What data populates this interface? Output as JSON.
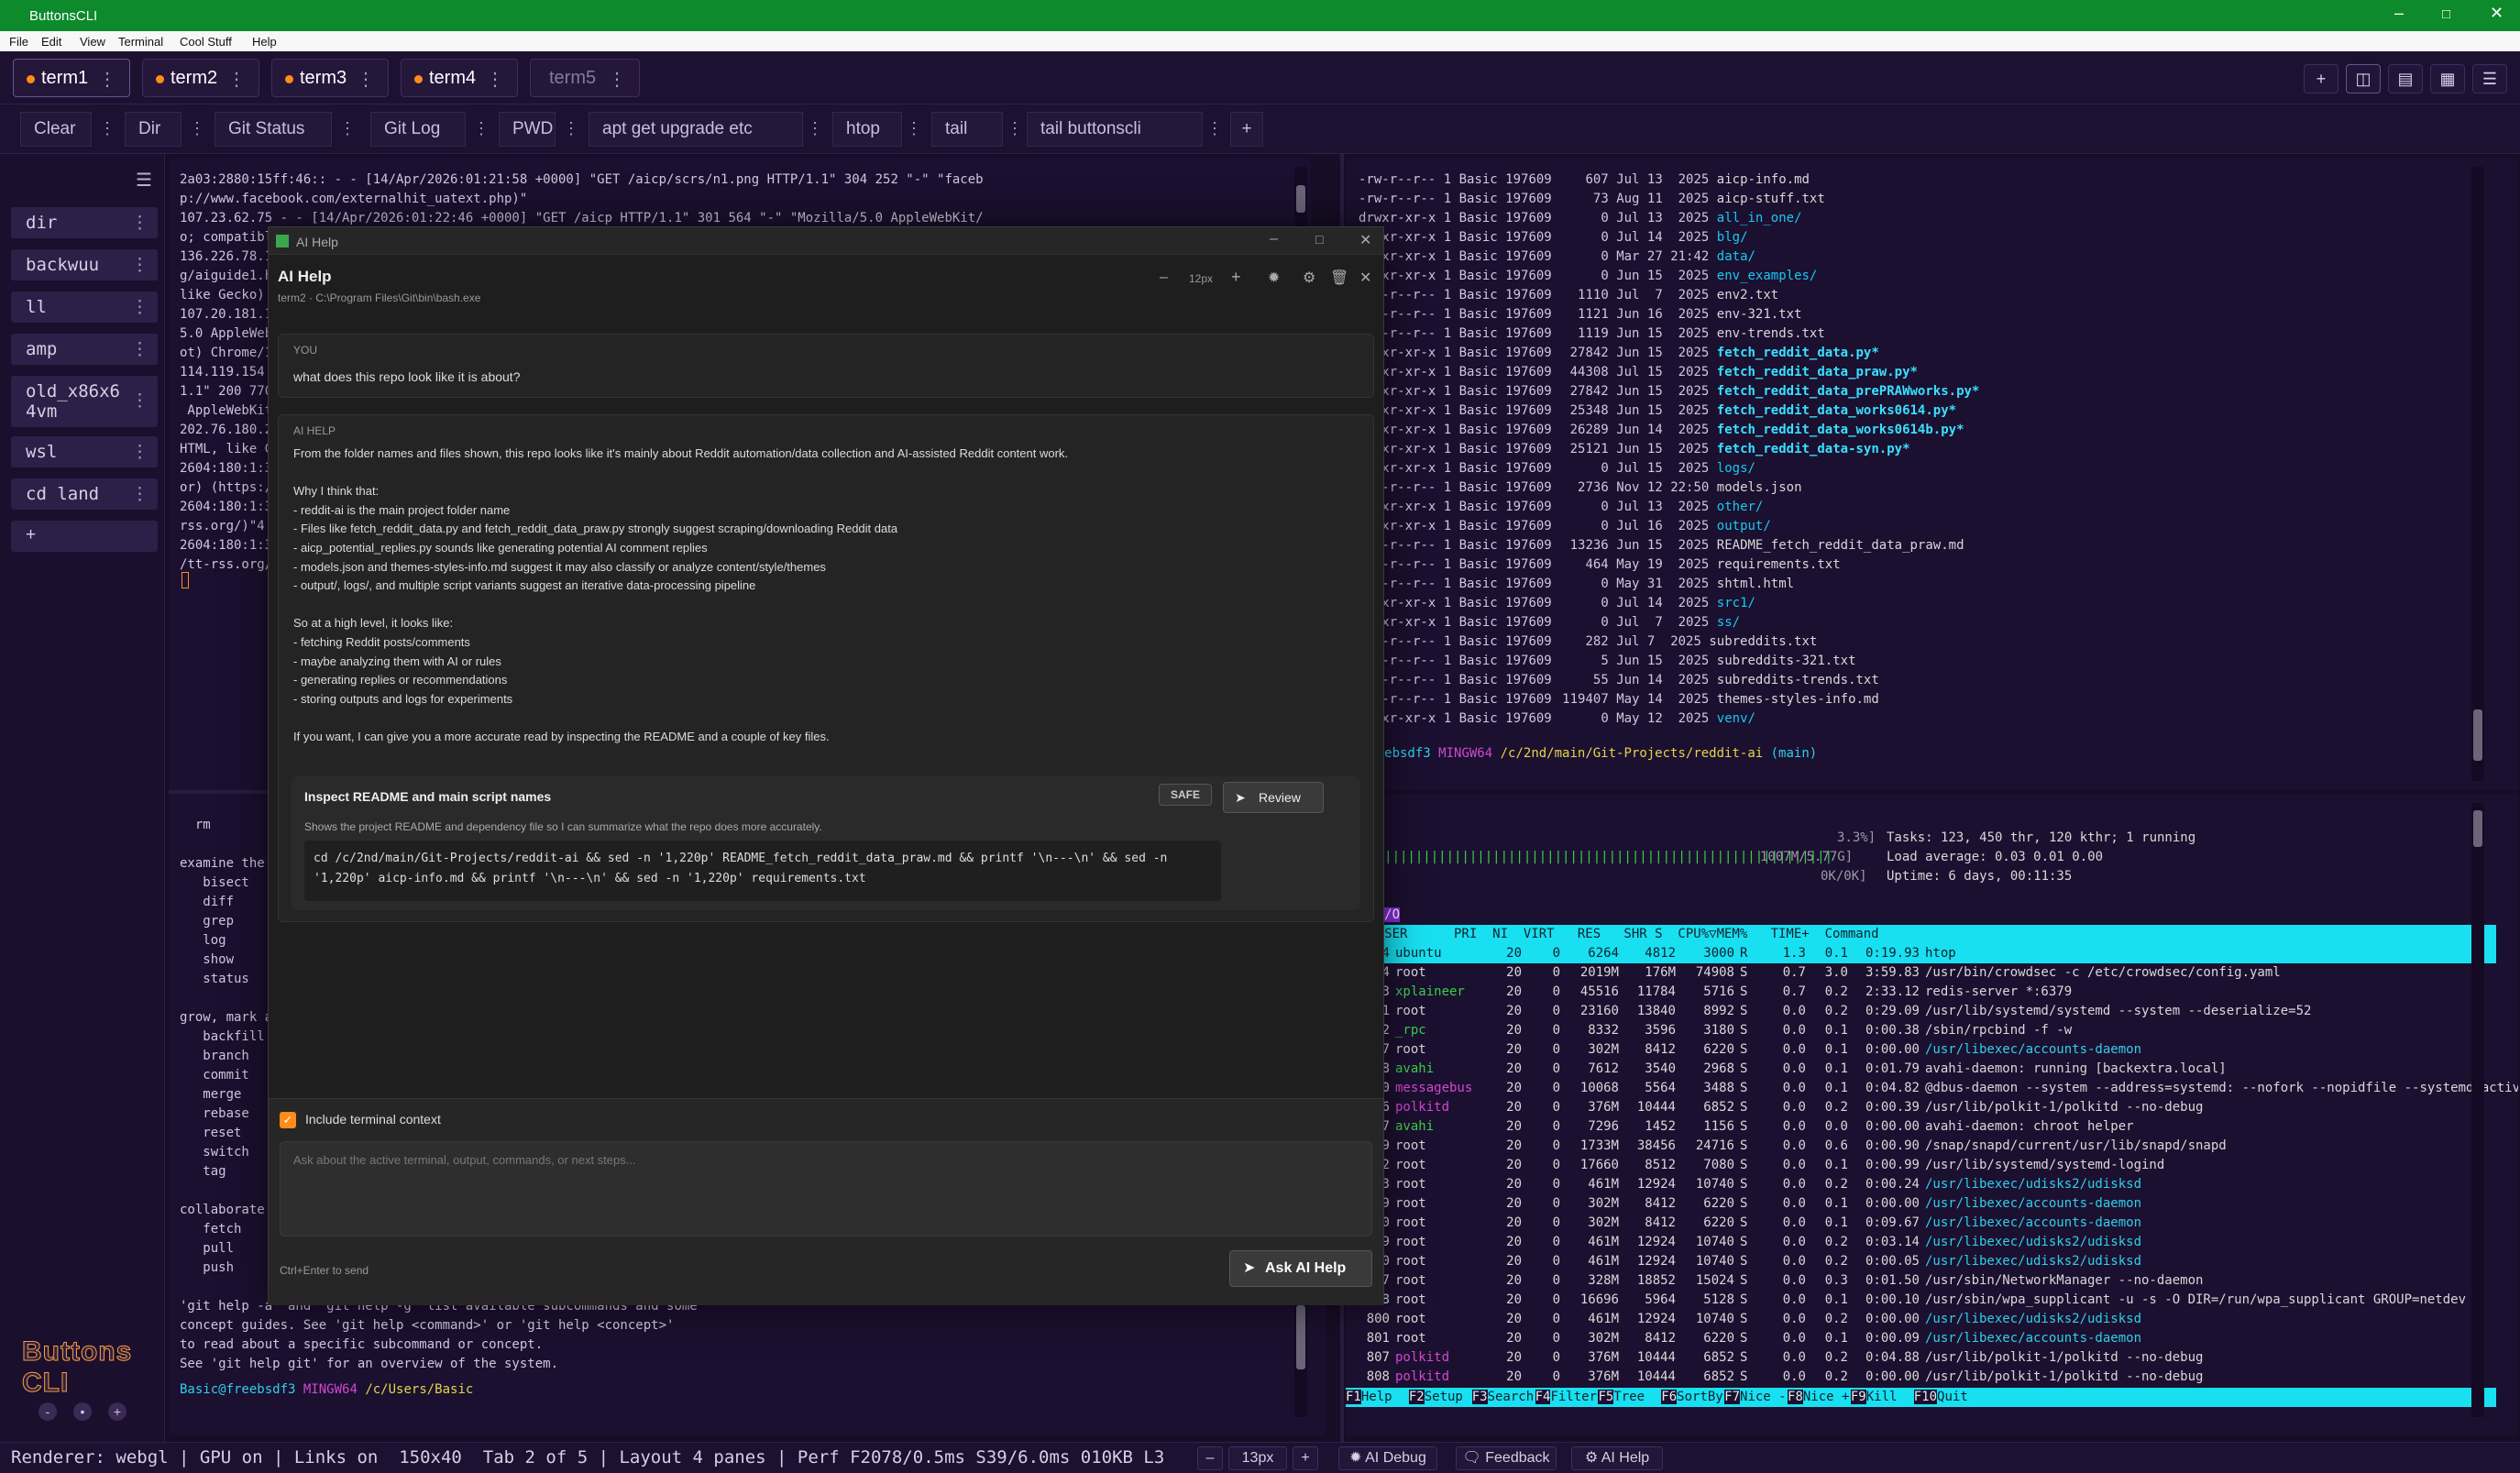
{
  "app": {
    "title": "ButtonsCLI",
    "brand": "Buttons CLI"
  },
  "menu": [
    "File",
    "Edit",
    "View",
    "Terminal",
    "Cool Stuff",
    "Help"
  ],
  "tabs": [
    {
      "label": "term1"
    },
    {
      "label": "term2"
    },
    {
      "label": "term3"
    },
    {
      "label": "term4"
    },
    {
      "label": "term5"
    }
  ],
  "toolbar": [
    "Clear",
    "Dir",
    "Git Status",
    "Git Log",
    "PWD",
    "apt get upgrade etc",
    "htop",
    "tail",
    "tail buttonscli"
  ],
  "toolbar_add": "+",
  "sidebar": [
    "dir",
    "backwuu",
    "ll",
    "amp",
    "old_x86x6\n4vm",
    "wsl",
    "cd land"
  ],
  "sidebar_add": "+",
  "sidebar_controls": [
    "-",
    "•",
    "+"
  ],
  "pane1_lines": [
    "2a03:2880:15ff:46:: - - [14/Apr/2026:01:21:58 +0000] \"GET /aicp/scrs/n1.png HTTP/1.1\" 304 252 \"-\" \"faceb",
    "p://www.facebook.com/externalhit_uatext.php)\"",
    "107.23.62.75 - - [14/Apr/2026:01:22:46 +0000] \"GET /aicp HTTP/1.1\" 301 564 \"-\" \"Mozilla/5.0 AppleWebKit/",
    "o; compatibl",
    "136.226.78.1",
    "g/aiguide1.h",
    "like Gecko)",
    "107.20.181.1",
    "5.0 AppleWeb",
    "ot) Chrome/1",
    "114.119.154.",
    "1.1\" 200 770",
    " AppleWebKit",
    "202.76.180.2",
    "HTML, like G",
    "2604:180:1:3",
    "or) (https:/",
    "2604:180:1:3",
    "rss.org/)\"4.",
    "2604:180:1:3",
    "/tt-rss.org/"
  ],
  "pane3_lines": [
    "  rm",
    "",
    "examine the",
    "   bisect",
    "   diff",
    "   grep",
    "   log",
    "   show",
    "   status",
    "",
    "grow, mark a",
    "   backfill",
    "   branch",
    "   commit",
    "   merge",
    "   rebase",
    "   reset",
    "   switch",
    "   tag",
    "",
    "collaborate",
    "   fetch",
    "   pull",
    "   push",
    "",
    "'git help -a' and 'git help -g' list available subcommands and some",
    "concept guides. See 'git help <command>' or 'git help <concept>'",
    "to read about a specific subcommand or concept.",
    "See 'git help git' for an overview of the system."
  ],
  "pane3_prompt": {
    "user": "Basic@freebsdf3",
    "env": "MINGW64",
    "path": "/c/Users/Basic"
  },
  "pane2_files": [
    {
      "p": "-rw-r--r--",
      "s": "607",
      "d": "Jul 13  2025",
      "n": "aicp-info.md",
      "c": "plain"
    },
    {
      "p": "-rw-r--r--",
      "s": "73",
      "d": "Aug 11  2025",
      "n": "aicp-stuff.txt",
      "c": "plain"
    },
    {
      "p": "drwxr-xr-x",
      "s": "0",
      "d": "Jul 13  2025",
      "n": "all_in_one/",
      "c": "dir"
    },
    {
      "p": "drwxr-xr-x",
      "s": "0",
      "d": "Jul 14  2025",
      "n": "blg/",
      "c": "dir"
    },
    {
      "p": "drwxr-xr-x",
      "s": "0",
      "d": "Mar 27 21:42",
      "n": "data/",
      "c": "dir"
    },
    {
      "p": "drwxr-xr-x",
      "s": "0",
      "d": "Jun 15  2025",
      "n": "env_examples/",
      "c": "dir"
    },
    {
      "p": "-rw-r--r--",
      "s": "1110",
      "d": "Jul  7  2025",
      "n": "env2.txt",
      "c": "plain"
    },
    {
      "p": "-rw-r--r--",
      "s": "1121",
      "d": "Jun 16  2025",
      "n": "env-321.txt",
      "c": "plain"
    },
    {
      "p": "-rw-r--r--",
      "s": "1119",
      "d": "Jun 15  2025",
      "n": "env-trends.txt",
      "c": "plain"
    },
    {
      "p": "-rwxr-xr-x",
      "s": "27842",
      "d": "Jun 15  2025",
      "n": "fetch_reddit_data.py*",
      "c": "exe"
    },
    {
      "p": "-rwxr-xr-x",
      "s": "44308",
      "d": "Jul 15  2025",
      "n": "fetch_reddit_data_praw.py*",
      "c": "exe"
    },
    {
      "p": "-rwxr-xr-x",
      "s": "27842",
      "d": "Jun 15  2025",
      "n": "fetch_reddit_data_prePRAWworks.py*",
      "c": "exe"
    },
    {
      "p": "-rwxr-xr-x",
      "s": "25348",
      "d": "Jun 15  2025",
      "n": "fetch_reddit_data_works0614.py*",
      "c": "exe"
    },
    {
      "p": "-rwxr-xr-x",
      "s": "26289",
      "d": "Jun 14  2025",
      "n": "fetch_reddit_data_works0614b.py*",
      "c": "exe"
    },
    {
      "p": "-rwxr-xr-x",
      "s": "25121",
      "d": "Jun 15  2025",
      "n": "fetch_reddit_data-syn.py*",
      "c": "exe"
    },
    {
      "p": "drwxr-xr-x",
      "s": "0",
      "d": "Jul 15  2025",
      "n": "logs/",
      "c": "dir"
    },
    {
      "p": "-rw-r--r--",
      "s": "2736",
      "d": "Nov 12 22:50",
      "n": "models.json",
      "c": "plain"
    },
    {
      "p": "drwxr-xr-x",
      "s": "0",
      "d": "Jul 13  2025",
      "n": "other/",
      "c": "dir"
    },
    {
      "p": "drwxr-xr-x",
      "s": "0",
      "d": "Jul 16  2025",
      "n": "output/",
      "c": "dir"
    },
    {
      "p": "-rw-r--r--",
      "s": "13236",
      "d": "Jun 15  2025",
      "n": "README_fetch_reddit_data_praw.md",
      "c": "plain"
    },
    {
      "p": "-rw-r--r--",
      "s": "464",
      "d": "May 19  2025",
      "n": "requirements.txt",
      "c": "plain"
    },
    {
      "p": "-rw-r--r--",
      "s": "0",
      "d": "May 31  2025",
      "n": "shtml.html",
      "c": "plain"
    },
    {
      "p": "drwxr-xr-x",
      "s": "0",
      "d": "Jul 14  2025",
      "n": "src1/",
      "c": "dir"
    },
    {
      "p": "drwxr-xr-x",
      "s": "0",
      "d": "Jul  7  2025",
      "n": "ss/",
      "c": "dir"
    },
    {
      "p": "-rw-r--r--",
      "s": "282",
      "d": "Jul 7  2025",
      "n": "subreddits.txt",
      "c": "plain"
    },
    {
      "p": "-rw-r--r--",
      "s": "5",
      "d": "Jun 15  2025",
      "n": "subreddits-321.txt",
      "c": "plain"
    },
    {
      "p": "-rw-r--r--",
      "s": "55",
      "d": "Jun 14  2025",
      "n": "subreddits-trends.txt",
      "c": "plain"
    },
    {
      "p": "-rw-r--r--",
      "s": "119407",
      "d": "May 14  2025",
      "n": "themes-styles-info.md",
      "c": "plain"
    },
    {
      "p": "drwxr-xr-x",
      "s": "0",
      "d": "May 12  2025",
      "n": "venv/",
      "c": "dir"
    }
  ],
  "pane2_links": "1 Basic 197609",
  "pane2_prompt": {
    "user": "c@freebsdf3",
    "env": "MINGW64",
    "path": "/c/2nd/main/Git-Projects/reddit-ai",
    "branch": "(main)"
  },
  "htop": {
    "cpu_right": "3.3%]",
    "tasks": "Tasks: 123, 450 thr, 120 kthr; 1 running",
    "mem_right": "1007M/5.77G]",
    "load": "Load average: 0.03 0.01 0.00",
    "swp_right": "0K/0K]",
    "uptime": "Uptime: 6 days, 00:11:35",
    "tab_main": "ain",
    "tab_io": "I/O",
    "header": "PID USER      PRI  NI  VIRT   RES   SHR S  CPU%▽MEM%   TIME+  Command",
    "rows": [
      [
        "224",
        "ubuntu",
        "20",
        "0",
        "6264",
        "4812",
        "3000",
        "R",
        "1.3",
        "0.1",
        "0:19.93",
        "htop"
      ],
      [
        "704",
        "root",
        "20",
        "0",
        "2019M",
        "176M",
        "74908",
        "S",
        "0.7",
        "3.0",
        "3:59.83",
        "/usr/bin/crowdsec -c /etc/crowdsec/config.yaml"
      ],
      [
        "253",
        "xplaineer",
        "20",
        "0",
        "45516",
        "11784",
        "5716",
        "S",
        "0.7",
        "0.2",
        "2:33.12",
        "redis-server *:6379"
      ],
      [
        "1",
        "root",
        "20",
        "0",
        "23160",
        "13840",
        "8992",
        "S",
        "0.0",
        "0.2",
        "0:29.09",
        "/usr/lib/systemd/systemd --system --deserialize=52"
      ],
      [
        "512",
        "_rpc",
        "20",
        "0",
        "8332",
        "3596",
        "3180",
        "S",
        "0.0",
        "0.1",
        "0:00.38",
        "/sbin/rpcbind -f -w"
      ],
      [
        "737",
        "root",
        "20",
        "0",
        "302M",
        "8412",
        "6220",
        "S",
        "0.0",
        "0.1",
        "0:00.00",
        "/usr/libexec/accounts-daemon"
      ],
      [
        "738",
        "avahi",
        "20",
        "0",
        "7612",
        "3540",
        "2968",
        "S",
        "0.0",
        "0.1",
        "0:01.79",
        "avahi-daemon: running [backextra.local]"
      ],
      [
        "740",
        "messagebus",
        "20",
        "0",
        "10068",
        "5564",
        "3488",
        "S",
        "0.0",
        "0.1",
        "0:04.82",
        "@dbus-daemon --system --address=systemd: --nofork --nopidfile --systemd-activation --"
      ],
      [
        "746",
        "polkitd",
        "20",
        "0",
        "376M",
        "10444",
        "6852",
        "S",
        "0.0",
        "0.2",
        "0:00.39",
        "/usr/lib/polkit-1/polkitd --no-debug"
      ],
      [
        "747",
        "avahi",
        "20",
        "0",
        "7296",
        "1452",
        "1156",
        "S",
        "0.0",
        "0.0",
        "0:00.00",
        "avahi-daemon: chroot helper"
      ],
      [
        "749",
        "root",
        "20",
        "0",
        "1733M",
        "38456",
        "24716",
        "S",
        "0.0",
        "0.6",
        "0:00.90",
        "/snap/snapd/current/usr/lib/snapd/snapd"
      ],
      [
        "752",
        "root",
        "20",
        "0",
        "17660",
        "8512",
        "7080",
        "S",
        "0.0",
        "0.1",
        "0:00.99",
        "/usr/lib/systemd/systemd-logind"
      ],
      [
        "753",
        "root",
        "20",
        "0",
        "461M",
        "12924",
        "10740",
        "S",
        "0.0",
        "0.2",
        "0:00.24",
        "/usr/libexec/udisks2/udisksd"
      ],
      [
        "769",
        "root",
        "20",
        "0",
        "302M",
        "8412",
        "6220",
        "S",
        "0.0",
        "0.1",
        "0:00.00",
        "/usr/libexec/accounts-daemon"
      ],
      [
        "770",
        "root",
        "20",
        "0",
        "302M",
        "8412",
        "6220",
        "S",
        "0.0",
        "0.1",
        "0:09.67",
        "/usr/libexec/accounts-daemon"
      ],
      [
        "779",
        "root",
        "20",
        "0",
        "461M",
        "12924",
        "10740",
        "S",
        "0.0",
        "0.2",
        "0:03.14",
        "/usr/libexec/udisks2/udisksd"
      ],
      [
        "780",
        "root",
        "20",
        "0",
        "461M",
        "12924",
        "10740",
        "S",
        "0.0",
        "0.2",
        "0:00.05",
        "/usr/libexec/udisks2/udisksd"
      ],
      [
        "797",
        "root",
        "20",
        "0",
        "328M",
        "18852",
        "15024",
        "S",
        "0.0",
        "0.3",
        "0:01.50",
        "/usr/sbin/NetworkManager --no-daemon"
      ],
      [
        "798",
        "root",
        "20",
        "0",
        "16696",
        "5964",
        "5128",
        "S",
        "0.0",
        "0.1",
        "0:00.10",
        "/usr/sbin/wpa_supplicant -u -s -O DIR=/run/wpa_supplicant GROUP=netdev"
      ],
      [
        "800",
        "root",
        "20",
        "0",
        "461M",
        "12924",
        "10740",
        "S",
        "0.0",
        "0.2",
        "0:00.00",
        "/usr/libexec/udisks2/udisksd"
      ],
      [
        "801",
        "root",
        "20",
        "0",
        "302M",
        "8412",
        "6220",
        "S",
        "0.0",
        "0.1",
        "0:00.09",
        "/usr/libexec/accounts-daemon"
      ],
      [
        "807",
        "polkitd",
        "20",
        "0",
        "376M",
        "10444",
        "6852",
        "S",
        "0.0",
        "0.2",
        "0:04.88",
        "/usr/lib/polkit-1/polkitd --no-debug"
      ],
      [
        "808",
        "polkitd",
        "20",
        "0",
        "376M",
        "10444",
        "6852",
        "S",
        "0.0",
        "0.2",
        "0:00.00",
        "/usr/lib/polkit-1/polkitd --no-debug"
      ]
    ],
    "fkeys": [
      [
        "F1",
        "Help"
      ],
      [
        "F2",
        "Setup"
      ],
      [
        "F3",
        "Search"
      ],
      [
        "F4",
        "Filter"
      ],
      [
        "F5",
        "Tree"
      ],
      [
        "F6",
        "SortBy"
      ],
      [
        "F7",
        "Nice -"
      ],
      [
        "F8",
        "Nice +"
      ],
      [
        "F9",
        "Kill"
      ],
      [
        "F10",
        "Quit"
      ]
    ]
  },
  "dialog": {
    "window_title": "AI Help",
    "title": "AI Help",
    "subtitle": "term2 · C:\\Program Files\\Git\\bin\\bash.exe",
    "font_size": "12px",
    "you_label": "YOU",
    "user_message": "what does this repo look like it is about?",
    "ai_label": "AI HELP",
    "ai_lines": [
      "From the folder names and files shown, this repo looks like it's mainly about Reddit automation/data collection and AI-assisted Reddit content work.",
      "",
      "Why I think that:",
      "- reddit-ai is the main project folder name",
      "- Files like fetch_reddit_data.py and fetch_reddit_data_praw.py strongly suggest scraping/downloading Reddit data",
      "- aicp_potential_replies.py sounds like generating potential AI comment replies",
      "- models.json and themes-styles-info.md suggest it may also classify or analyze content/style/themes",
      "- output/, logs/, and multiple script variants suggest an iterative data-processing pipeline",
      "",
      "So at a high level, it looks like:",
      "- fetching Reddit posts/comments",
      "- maybe analyzing them with AI or rules",
      "- generating replies or recommendations",
      "- storing outputs and logs for experiments",
      "",
      "If you want, I can give you a more accurate read by inspecting the README and a couple of key files."
    ],
    "action_title": "Inspect README and main script names",
    "action_badge": "SAFE",
    "action_button": "Review",
    "action_desc": "Shows the project README and dependency file so I can summarize what the repo does more accurately.",
    "action_cmd_1": "cd /c/2nd/main/Git-Projects/reddit-ai && sed -n '1,220p' README_fetch_reddit_data_praw.md && printf '\\n---\\n' && sed -n",
    "action_cmd_2": "'1,220p' aicp-info.md && printf '\\n---\\n' && sed -n '1,220p' requirements.txt",
    "context_label": "Include terminal context",
    "input_placeholder": "Ask about the active terminal, output, commands, or next steps...",
    "send_hint": "Ctrl+Enter to send",
    "ask_button": "Ask AI Help"
  },
  "status": {
    "text": "Renderer: webgl | GPU on | Links on  150x40  Tab 2 of 5 | Layout 4 panes | Perf F2078/0.5ms S39/6.0ms 010KB L3",
    "zoom": "13px",
    "ai_debug": "AI Debug",
    "feedback": "Feedback",
    "ai_help": "AI Help"
  },
  "colors": {
    "accent": "#ff8c1a",
    "titlebar": "#0c8a2c",
    "dir": "#18c9f0",
    "exe": "#39e0ff",
    "htop_bar": "#18e0f0"
  }
}
